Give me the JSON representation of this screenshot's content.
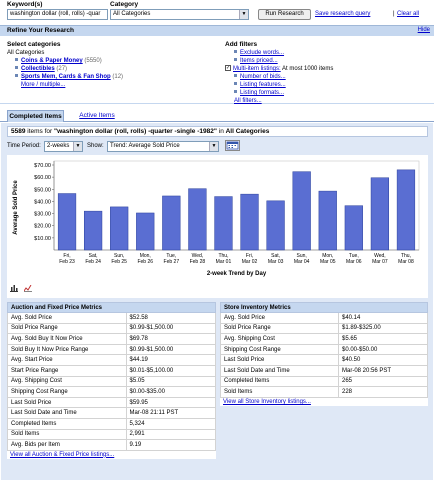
{
  "search": {
    "keywords_label": "Keyword(s)",
    "keywords_value": "washington dollar (roll, rolls) -quar",
    "category_label": "Category",
    "category_value": "All Categories",
    "run_button": "Run Research",
    "save_link": "Save research query",
    "clear_link": "Clear all"
  },
  "refine": {
    "title": "Refine Your Research",
    "hide_link": "Hide",
    "select_heading": "Select categories",
    "all_categories": "All Categories",
    "categories": [
      {
        "label": "Coins & Paper Money",
        "count": "(5550)"
      },
      {
        "label": "Collectibles",
        "count": "(27)"
      },
      {
        "label": "Sports Mem, Cards & Fan Shop",
        "count": "(12)"
      }
    ],
    "more_link": "More / multiple...",
    "filters_heading": "Add filters",
    "filters": [
      {
        "label": "Exclude words...",
        "checkbox": false
      },
      {
        "label": "Items priced...",
        "checkbox": false
      },
      {
        "label": "Multi-item listings:",
        "checkbox": true,
        "note": "At most 1000 items"
      },
      {
        "label": "Number of bids...",
        "checkbox": false
      },
      {
        "label": "Listing features...",
        "checkbox": false
      },
      {
        "label": "Listing formats...",
        "checkbox": false
      }
    ],
    "all_filters": "All filters..."
  },
  "tabs": [
    {
      "label": "Completed Items",
      "active": true
    },
    {
      "label": "Active Items",
      "active": false
    }
  ],
  "results": {
    "count": "5589",
    "middle": " items for ",
    "query": "\"washington dollar (roll, rolls) -quarter -single -1982\"",
    "in": " in ",
    "category": "All Categories"
  },
  "controls": {
    "period_label": "Time Period:",
    "period_value": "2-weeks",
    "show_label": "Show:",
    "show_value": "Trend: Average Sold Price"
  },
  "chart_data": {
    "type": "bar",
    "ylabel": "Average Sold Price",
    "xlabel": "2-week Trend by Day",
    "ylim": [
      0,
      70
    ],
    "yticks": [
      "$10.00",
      "$20.00",
      "$30.00",
      "$40.00",
      "$50.00",
      "$60.00",
      "$70.00"
    ],
    "categories": [
      [
        "Fri,",
        "Feb 23"
      ],
      [
        "Sat,",
        "Feb 24"
      ],
      [
        "Sun,",
        "Feb 25"
      ],
      [
        "Mon,",
        "Feb 26"
      ],
      [
        "Tue,",
        "Feb 27"
      ],
      [
        "Wed,",
        "Feb 28"
      ],
      [
        "Thu,",
        "Mar 01"
      ],
      [
        "Fri,",
        "Mar 02"
      ],
      [
        "Sat,",
        "Mar 03"
      ],
      [
        "Sun,",
        "Mar 04"
      ],
      [
        "Mon,",
        "Mar 05"
      ],
      [
        "Tue,",
        "Mar 06"
      ],
      [
        "Wed,",
        "Mar 07"
      ],
      [
        "Thu,",
        "Mar 08"
      ]
    ],
    "values": [
      46.5,
      32,
      35.5,
      30.5,
      44.5,
      50.5,
      44,
      46,
      40.5,
      64.5,
      48.5,
      36.5,
      59.5,
      66
    ],
    "bar_color": "#5a6ed2",
    "grid": false
  },
  "auction": {
    "title": "Auction and Fixed Price Metrics",
    "rows": [
      [
        "Avg. Sold Price",
        "$52.58"
      ],
      [
        "Sold Price Range",
        "$0.99-$1,500.00"
      ],
      [
        "Avg. Sold Buy It Now Price",
        "$69.78"
      ],
      [
        "Sold Buy It Now Price Range",
        "$0.99-$1,500.00"
      ],
      [
        "Avg. Start Price",
        "$44.19"
      ],
      [
        "Start Price Range",
        "$0.01-$5,100.00"
      ],
      [
        "Avg. Shipping Cost",
        "$5.05"
      ],
      [
        "Shipping Cost Range",
        "$0.00-$35.00"
      ],
      [
        "Last Sold Price",
        "$59.95"
      ],
      [
        "Last Sold Date and Time",
        "Mar-08 21:11 PST"
      ],
      [
        "Completed Items",
        "5,324"
      ],
      [
        "Sold Items",
        "2,991"
      ],
      [
        "Avg. Bids per Item",
        "9.19"
      ]
    ],
    "view_all": "View all Auction & Fixed Price listings..."
  },
  "store": {
    "title": "Store Inventory Metrics",
    "rows": [
      [
        "Avg. Sold Price",
        "$40.14"
      ],
      [
        "Sold Price Range",
        "$1.89-$325.00"
      ],
      [
        "Avg. Shipping Cost",
        "$5.65"
      ],
      [
        "Shipping Cost Range",
        "$0.00-$50.00"
      ],
      [
        "Last Sold Price",
        "$40.50"
      ],
      [
        "Last Sold Date and Time",
        "Mar-08 20:56 PST"
      ],
      [
        "Completed Items",
        "265"
      ],
      [
        "Sold Items",
        "228"
      ]
    ],
    "view_all": "View all Store Inventory listings..."
  }
}
